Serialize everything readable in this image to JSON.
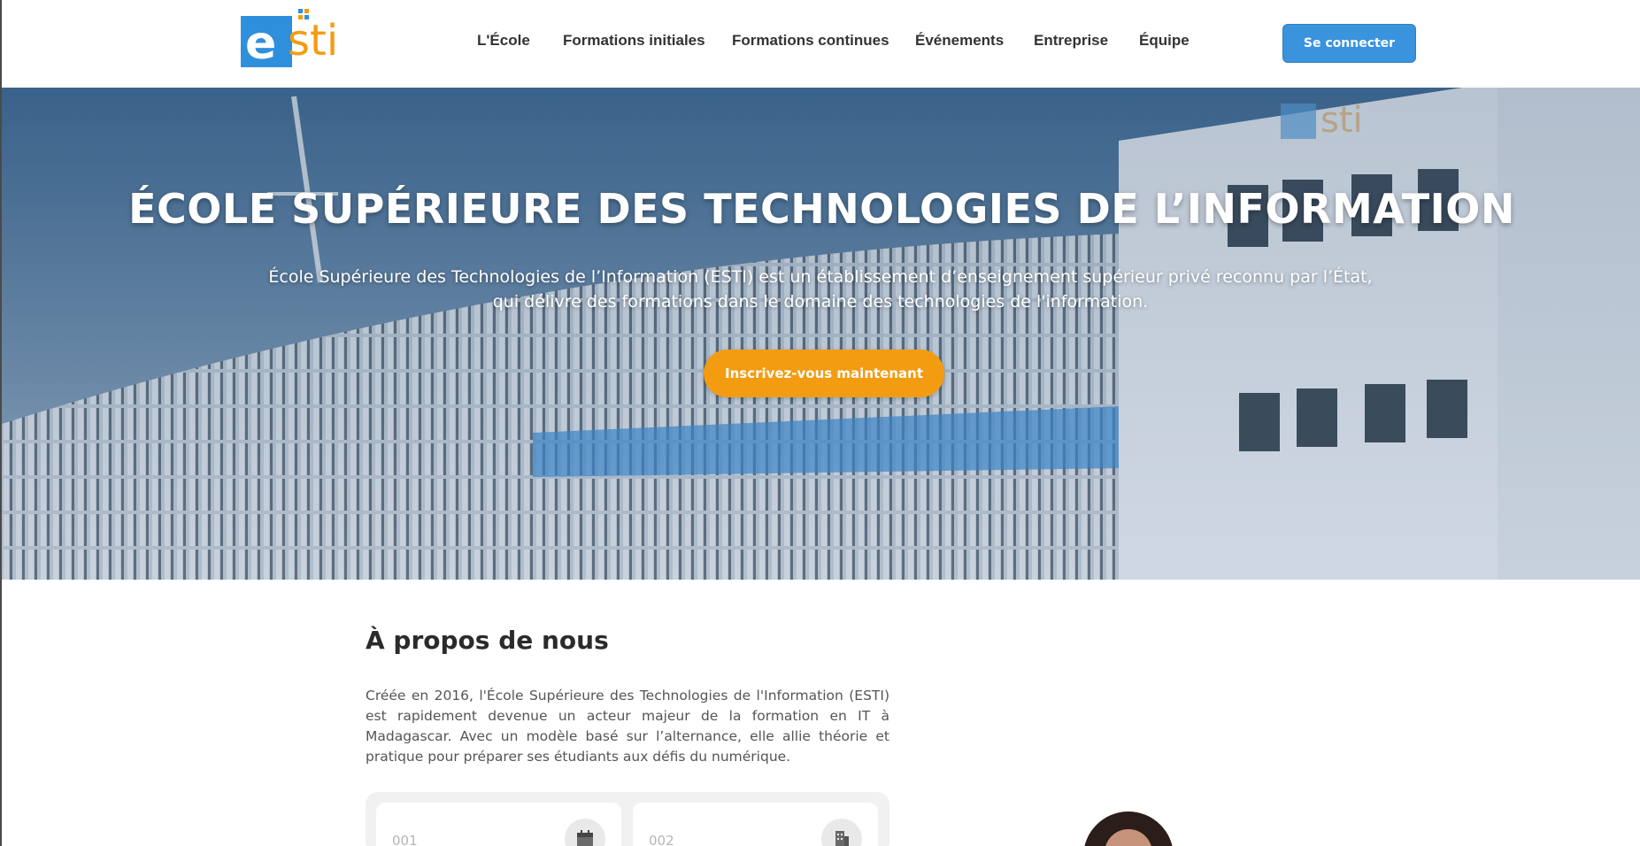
{
  "header": {
    "logo_alt": "esti",
    "nav": [
      {
        "label": "L'École"
      },
      {
        "label": "Formations initiales"
      },
      {
        "label": "Formations continues"
      },
      {
        "label": "Événements"
      },
      {
        "label": "Entreprise"
      },
      {
        "label": "Équipe"
      }
    ],
    "login_label": "Se connecter"
  },
  "hero": {
    "title": "ÉCOLE SUPÉRIEURE DES TECHNOLOGIES DE L’INFORMATION",
    "description": "École Supérieure des Technologies de l’Information (ESTI) est un établissement d’enseignement supérieur privé reconnu par l’État, qui délivre des formations dans le domaine des technologies de l'information.",
    "cta_label": "Inscrivez-vous maintenant"
  },
  "about": {
    "title": "À propos de nous",
    "text": "Créée en 2016, l'École Supérieure des Technologies de l'Information (ESTI) est rapidement devenue un acteur majeur de la formation en IT à Madagascar. Avec un modèle basé sur l’alternance, elle allie théorie et pratique pour préparer ses étudiants aux défis du numérique.",
    "cards": [
      {
        "number": "001",
        "icon": "calendar-icon"
      },
      {
        "number": "002",
        "icon": "building-icon"
      }
    ]
  },
  "colors": {
    "brand_blue": "#3a93dd",
    "brand_orange": "#f39c12"
  }
}
